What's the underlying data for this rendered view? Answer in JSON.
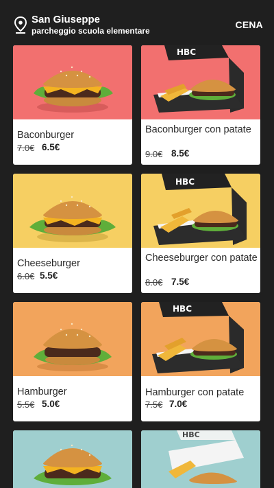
{
  "header": {
    "location_title": "San Giuseppe",
    "location_subtitle": "parcheggio scuola elementare",
    "mode": "CENA"
  },
  "colors": {
    "background": "#1f1f1f",
    "red_bg": "#f2706f",
    "yellow_bg": "#f6cf62",
    "orange_bg": "#f2a45c",
    "teal_bg": "#9fcfcf"
  },
  "products": [
    {
      "name": "Baconburger",
      "old_price": "7.0€",
      "price": "6.5€",
      "icon": "burger-image"
    },
    {
      "name": "Baconburger con patate",
      "old_price": "9.0€",
      "price": "8.5€",
      "icon": "burger-box-image"
    },
    {
      "name": "Cheeseburger",
      "old_price": "6.0€",
      "price": "5.5€",
      "icon": "burger-image"
    },
    {
      "name": "Cheeseburger con patate",
      "old_price": "8.0€",
      "price": "7.5€",
      "icon": "burger-box-image"
    },
    {
      "name": "Hamburger",
      "old_price": "5.5€",
      "price": "5.0€",
      "icon": "burger-image"
    },
    {
      "name": "Hamburger con patate",
      "old_price": "7.5€",
      "price": "7.0€",
      "icon": "burger-box-image"
    },
    {
      "name": "",
      "old_price": "",
      "price": "",
      "icon": "burger-image"
    },
    {
      "name": "",
      "old_price": "",
      "price": "",
      "icon": "burger-box-image"
    }
  ],
  "box_brand": "HBC"
}
